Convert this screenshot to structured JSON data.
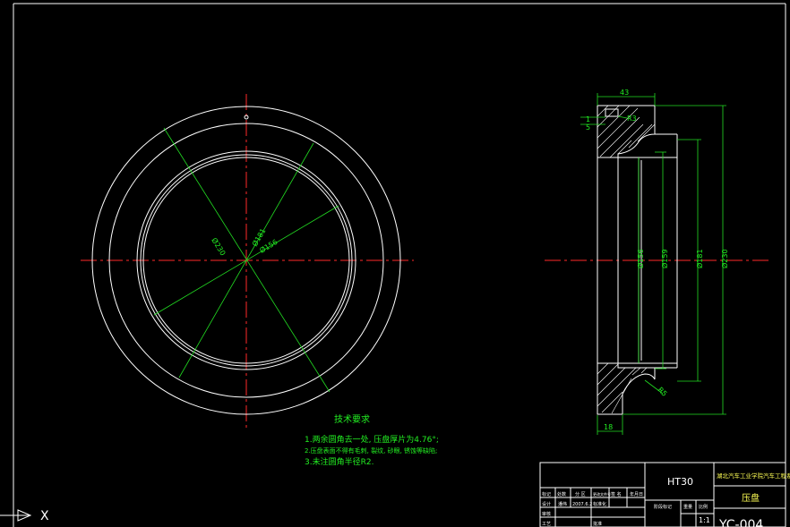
{
  "colors": {
    "background": "#000000",
    "outline": "#ffffff",
    "center_line": "#ff2a2a",
    "dimension": "#22dd22",
    "title_yellow": "#ffff55"
  },
  "front_view": {
    "dims": {
      "d230": "Ø230",
      "d181": "Ø181",
      "d156": "Ø156"
    }
  },
  "section_view": {
    "dims": {
      "width_top": "43",
      "width_bottom": "18",
      "r3": "R3",
      "r5": "R5",
      "d156": "Ø156",
      "d159": "Ø159",
      "d181": "Ø181",
      "d230": "Ø230",
      "small_a": "1",
      "small_b": "5"
    }
  },
  "tech_requirements": {
    "title": "技术要求",
    "items": [
      "1.两余圆角去一处, 压盘厚片为4.76°;",
      "2.压盘表面不得有毛刺, 裂纹, 砂眼, 锈蚀等缺陷;",
      "3.未注圆角半径R2."
    ]
  },
  "title_block": {
    "material": "HT30",
    "institution": "湖北汽车工业学院汽车工程系",
    "part_name": "压盘",
    "scale": "1:1",
    "drawing_no": "YC-004",
    "row_labels": [
      "标记",
      "处数",
      "分 区",
      "更改文件号",
      "签 名",
      "年月日"
    ],
    "design_label": "设计",
    "design_name": "潘伟",
    "design_date": "2007.6.2",
    "std_label": "标准化",
    "stage_label": "阶段标记",
    "weight_label": "重量",
    "ratio_label": "比例",
    "audit_label": "审核",
    "process_label": "工艺",
    "approve_label": "批准"
  },
  "ucs_label": "X"
}
